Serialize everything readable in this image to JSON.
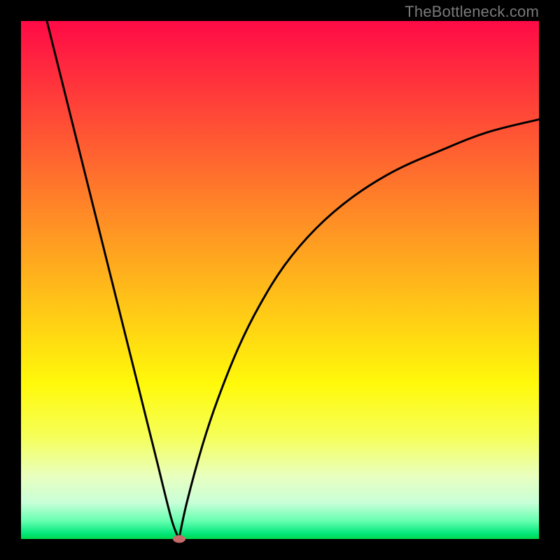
{
  "watermark": "TheBottleneck.com",
  "chart_data": {
    "type": "line",
    "title": "",
    "xlabel": "",
    "ylabel": "",
    "xlim": [
      0,
      100
    ],
    "ylim": [
      0,
      100
    ],
    "grid": false,
    "series": [
      {
        "name": "bottleneck-curve-left",
        "x": [
          5,
          8,
          11,
          14,
          17,
          20,
          23,
          26,
          29,
          30.5
        ],
        "values": [
          100,
          88,
          76,
          64,
          52,
          40,
          28,
          16,
          4,
          0
        ]
      },
      {
        "name": "bottleneck-curve-right",
        "x": [
          30.5,
          32,
          35,
          38,
          42,
          46,
          51,
          57,
          64,
          72,
          81,
          90,
          100
        ],
        "values": [
          0,
          7,
          18,
          27,
          37,
          45,
          53,
          60,
          66,
          71,
          75,
          78.5,
          81
        ]
      }
    ],
    "marker": {
      "x": 30.5,
      "y": 0
    },
    "gradient_stops": [
      {
        "pos": 0,
        "color": "#ff0a46"
      },
      {
        "pos": 14,
        "color": "#ff3a3a"
      },
      {
        "pos": 28,
        "color": "#ff6a2e"
      },
      {
        "pos": 42,
        "color": "#ff9a22"
      },
      {
        "pos": 56,
        "color": "#ffc916"
      },
      {
        "pos": 70,
        "color": "#fff90a"
      },
      {
        "pos": 80,
        "color": "#f6ff56"
      },
      {
        "pos": 88,
        "color": "#e8ffc0"
      },
      {
        "pos": 93,
        "color": "#c8ffd8"
      },
      {
        "pos": 96.5,
        "color": "#66ffb0"
      },
      {
        "pos": 99,
        "color": "#00e77a"
      },
      {
        "pos": 100,
        "color": "#00d84a"
      }
    ]
  }
}
